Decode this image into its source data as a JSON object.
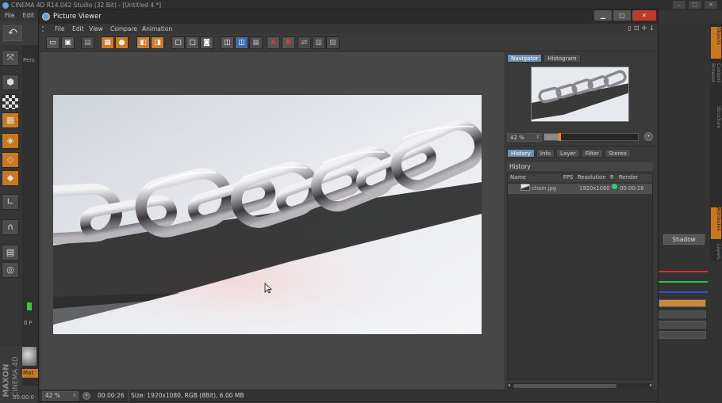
{
  "app": {
    "title": "CINEMA 4D R14.042 Studio (32 Bit) - [Untitled 4 *]",
    "menu": [
      "File",
      "Edit"
    ],
    "brand_maxon": "MAXON",
    "brand_c4d": "CINEMA 4D",
    "viewport_label": "Pers",
    "frame_field": "0 F",
    "material_label": "Mat",
    "bottom_time": "00:00:0",
    "shadow_button": "Shadow",
    "right_tabs": [
      "Objects",
      "Content Browser",
      "Structure",
      "Attributes",
      "Layers"
    ]
  },
  "picture_viewer": {
    "title": "Picture Viewer",
    "menu": [
      "File",
      "Edit",
      "View",
      "Compare",
      "Animation"
    ],
    "toolbar_icons": [
      "open-icon",
      "save-icon",
      "render-queue-icon",
      "grid-icon",
      "orange-render-icon",
      "orange-user-icon",
      "orange-export-icon",
      "orange-settings-icon",
      "ab-view-icon",
      "ab-compare-icon",
      "tv-icon",
      "split-icon",
      "split-active-icon",
      "split-grid-icon",
      "set-a-icon",
      "set-b-icon",
      "swap-icon",
      "text-icon",
      "diff-icon"
    ],
    "navigator": {
      "tabs": [
        "Navigator",
        "Histogram"
      ],
      "zoom": "42 %",
      "zoom_fraction": 0.42
    },
    "history_panel": {
      "tabs": [
        "History",
        "Info",
        "Layer",
        "Filter",
        "Stereo"
      ],
      "header": "History",
      "columns": [
        "Name",
        "FPS",
        "Resolution",
        "R",
        "Render Time"
      ],
      "rows": [
        {
          "name": "chain.jpg",
          "fps": "",
          "resolution": "1920x1080",
          "render_time": "00:00:26"
        }
      ]
    },
    "status": {
      "zoom": "42 %",
      "time": "00:00:26",
      "info": "Size: 1920x1080, RGB (8Bit), 6.00 MB"
    }
  }
}
